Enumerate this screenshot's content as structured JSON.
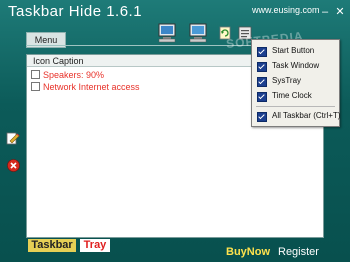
{
  "app": {
    "title": "Taskbar Hide 1.6.1",
    "website": "www.eusing.com",
    "watermark": "SOFTPEDIA"
  },
  "titlebar": {
    "minimize_symbol": "–",
    "close_symbol": "✕"
  },
  "menu": {
    "label": "Menu"
  },
  "toolbar_icons": [
    "taskbar-icon",
    "window-icon",
    "refresh-icon",
    "settings-icon"
  ],
  "list": {
    "header": "Icon Caption",
    "rows": [
      {
        "label": "Speakers: 90%",
        "checked": false
      },
      {
        "label": "Network Internet access",
        "checked": false
      }
    ]
  },
  "side_icons": [
    "edit-icon",
    "remove-icon"
  ],
  "tabs": {
    "taskbar": "Taskbar",
    "tray": "Tray"
  },
  "footer": {
    "buy_now": "BuyNow",
    "register": "Register"
  },
  "dropdown": {
    "items": [
      {
        "label": "Start Button",
        "checked": true
      },
      {
        "label": "Task Window",
        "checked": true
      },
      {
        "label": "SysTray",
        "checked": true
      },
      {
        "label": "Time Clock",
        "checked": true
      },
      {
        "label": "All Taskbar  (Ctrl+T)",
        "checked": true
      }
    ]
  },
  "colors": {
    "background": "#0c5b59",
    "row_text": "#e8322a",
    "buy_now": "#ffe24d",
    "tab_active": "#e6cf55"
  }
}
